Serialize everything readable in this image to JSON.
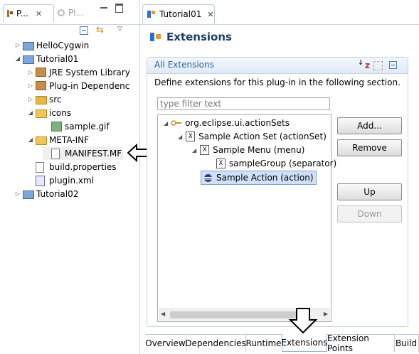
{
  "left_panel": {
    "tabs": [
      {
        "label": "P...",
        "icon": "package-explorer-icon"
      },
      {
        "label": "Pl...",
        "icon": "plugins-icon"
      }
    ],
    "tree": [
      {
        "label": "HelloCygwin",
        "depth": 0,
        "expand": "▷",
        "icon": "project-icon"
      },
      {
        "label": "Tutorial01",
        "depth": 0,
        "expand": "◢",
        "icon": "project-icon"
      },
      {
        "label": "JRE System Library",
        "depth": 1,
        "expand": "▷",
        "icon": "library-icon"
      },
      {
        "label": "Plug-in Dependenc",
        "depth": 1,
        "expand": "▷",
        "icon": "library-icon"
      },
      {
        "label": "src",
        "depth": 1,
        "expand": "▷",
        "icon": "source-folder-icon"
      },
      {
        "label": "icons",
        "depth": 1,
        "expand": "◢",
        "icon": "folder-icon"
      },
      {
        "label": "sample.gif",
        "depth": 2,
        "expand": "",
        "icon": "gif-icon"
      },
      {
        "label": "META-INF",
        "depth": 1,
        "expand": "◢",
        "icon": "folder-icon"
      },
      {
        "label": "MANIFEST.MF",
        "depth": 2,
        "expand": "",
        "icon": "file-icon"
      },
      {
        "label": "build.properties",
        "depth": 1,
        "expand": "",
        "icon": "file-icon"
      },
      {
        "label": "plugin.xml",
        "depth": 1,
        "expand": "",
        "icon": "xml-icon"
      },
      {
        "label": "Tutorial02",
        "depth": 0,
        "expand": "▷",
        "icon": "project-icon"
      }
    ]
  },
  "editor": {
    "tab_label": "Tutorial01",
    "page_title": "Extensions",
    "section_title": "All Extensions",
    "description": "Define extensions for this plug-in in the following section.",
    "filter_placeholder": "type filter text",
    "tree": [
      {
        "label": "org.eclipse.ui.actionSets",
        "depth": 0,
        "icon": "extension-point-icon"
      },
      {
        "label": "Sample Action Set (actionSet)",
        "depth": 1,
        "icon": "element-icon"
      },
      {
        "label": "Sample Menu (menu)",
        "depth": 2,
        "icon": "element-icon"
      },
      {
        "label": "sampleGroup (separator)",
        "depth": 3,
        "icon": "element-icon"
      },
      {
        "label": "Sample Action (action)",
        "depth": 2,
        "icon": "action-icon",
        "selected": true
      }
    ],
    "buttons": {
      "add": "Add...",
      "remove": "Remove",
      "up": "Up",
      "down": "Down"
    },
    "bottom_tabs": [
      "Overview",
      "Dependencies",
      "Runtime",
      "Extensions",
      "Extension Points",
      "Build"
    ],
    "active_bottom_tab": "Extensions"
  },
  "colors": {
    "header_text": "#1d3d66",
    "section_title_text": "#3060a0",
    "selection": "#cfe0f8"
  }
}
